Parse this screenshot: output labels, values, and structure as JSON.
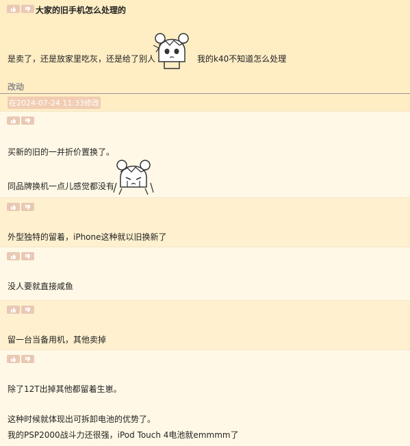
{
  "thread": {
    "title": "大家的旧手机怎么处理的",
    "body_before": "是卖了，还是放家里吃灰，还是给了别人",
    "body_after": "我的k40不知道怎么处理",
    "sticker_1": "anime-girl-sticker",
    "edit_label": "改动",
    "edit_time": "在2024-07-24 11:33修改"
  },
  "icons": {
    "like": "thumbs-up-icon",
    "dislike": "thumbs-down-icon"
  },
  "colors": {
    "vote_bg": "#e9c9b4",
    "main_bg": "#ffedc4",
    "alt_bg": "#fff1cf",
    "plain_bg": "#fff8e6"
  },
  "replies": [
    {
      "lines": [
        "买新的旧的一并折价置换了。",
        "同品牌换机一点儿感觉都没有"
      ],
      "sticker": "anime-girl-crying-sticker"
    },
    {
      "lines": [
        "外型独特的留着，iPhone这种就以旧换新了"
      ]
    },
    {
      "lines": [
        "没人要就直接咸鱼"
      ]
    },
    {
      "lines": [
        "留一台当备用机，其他卖掉"
      ]
    },
    {
      "lines": [
        "除了12T出掉其他都留着生崽。",
        "这种时候就体现出可拆卸电池的优势了。",
        "我的PSP2000战斗力还很强，iPod Touch 4电池就emmmm了"
      ]
    }
  ]
}
